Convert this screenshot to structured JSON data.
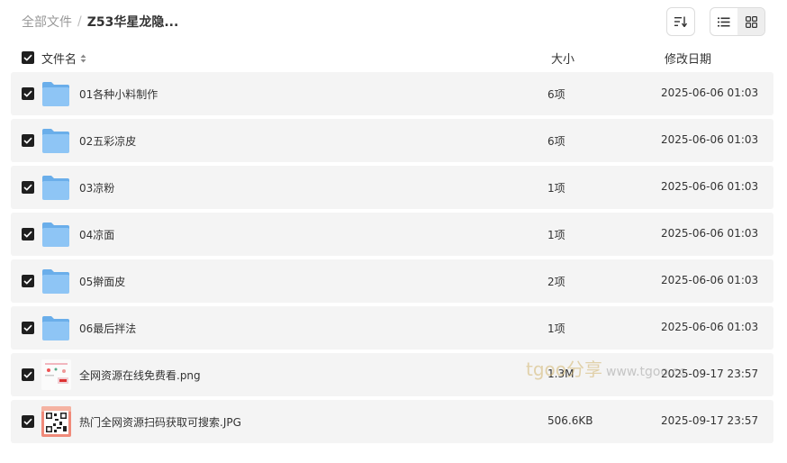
{
  "breadcrumb": {
    "root": "全部文件",
    "separator": "/",
    "current": "Z53华星龙隐..."
  },
  "toolbar": {
    "sort_icon": "sort-icon",
    "list_view_icon": "list-view-icon",
    "grid_view_icon": "grid-view-icon",
    "active_view": "list"
  },
  "table_header": {
    "name": "文件名",
    "size": "大小",
    "date": "修改日期"
  },
  "files": [
    {
      "name": "01各种小料制作",
      "size": "6项",
      "date": "2025-06-06 01:03",
      "type": "folder",
      "checked": true
    },
    {
      "name": "02五彩凉皮",
      "size": "6项",
      "date": "2025-06-06 01:03",
      "type": "folder",
      "checked": true
    },
    {
      "name": "03凉粉",
      "size": "1项",
      "date": "2025-06-06 01:03",
      "type": "folder",
      "checked": true
    },
    {
      "name": "04凉面",
      "size": "1项",
      "date": "2025-06-06 01:03",
      "type": "folder",
      "checked": true
    },
    {
      "name": "05擀面皮",
      "size": "2项",
      "date": "2025-06-06 01:03",
      "type": "folder",
      "checked": true
    },
    {
      "name": "06最后拌法",
      "size": "1项",
      "date": "2025-06-06 01:03",
      "type": "folder",
      "checked": true
    },
    {
      "name": "全网资源在线免费看.png",
      "size": "1.3M",
      "date": "2025-09-17 23:57",
      "type": "image",
      "checked": true
    },
    {
      "name": "热门全网资源扫码获取可搜索.JPG",
      "size": "506.6KB",
      "date": "2025-09-17 23:57",
      "type": "qr-image",
      "checked": true
    }
  ],
  "watermark": {
    "brand": "tgoo分享",
    "url": "www.tgoo.cc"
  },
  "colors": {
    "row_bg": "#f4f4f4",
    "folder": "#7cb9f0",
    "checkbox": "#1f1f1f"
  }
}
